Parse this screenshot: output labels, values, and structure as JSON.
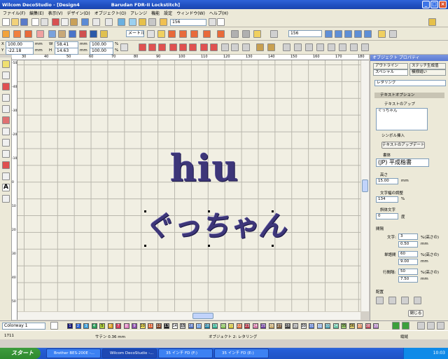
{
  "window": {
    "app": "Wilcom DecoStudio",
    "doc": "[Design4",
    "machine": "Barudan FDR-II Lockstitch]"
  },
  "menu": [
    "ファイル(F)",
    "編集(E)",
    "表示(V)",
    "デザイン(D)",
    "オブジェクト(O)",
    "アレンジ",
    "機能",
    "設定",
    "ウィンドウ(W)",
    "ヘルプ(H)"
  ],
  "toolbar1": {
    "value_156": "156",
    "value_156b": "156",
    "dropdown_label": "メートル法"
  },
  "coords": {
    "x": "100.00",
    "y": "-22.18",
    "w": "58.41",
    "h": "14.63",
    "unit": "mm",
    "sx": "100.00",
    "sy": "100.00",
    "pct": "%"
  },
  "rulers": {
    "top": [
      "30",
      "40",
      "50",
      "60",
      "70",
      "80",
      "90",
      "100",
      "110",
      "120",
      "130",
      "140",
      "150",
      "160",
      "170",
      "180"
    ],
    "left": [
      "-50",
      "-40",
      "-30",
      "-20",
      "-10",
      "0",
      "10",
      "20",
      "30",
      "40",
      "50"
    ]
  },
  "design": {
    "line1": "hiu",
    "line2": "ぐっちゃん"
  },
  "panel": {
    "title": "オブジェクト プロパティ",
    "tabs": [
      "アウトライン",
      "ステッチ生成值",
      "スペシャル",
      "模様縫い"
    ],
    "object_type": "レタリング",
    "section": "テキストオプション",
    "text_label": "テキストのアップ",
    "text_value": "ぐっちゃん",
    "symbol_label": "シンボル挿入",
    "update_button": "テキストのアップデート",
    "font_label": "書体",
    "font_value": "(JP) 平成楷書",
    "height_label": "高さ",
    "height_value": "15.00",
    "height_unit": "mm",
    "width_label": "文字幅の調整",
    "width_value": "134",
    "width_unit": "%",
    "italic_label": "斜体文字",
    "italic_value": "0",
    "italic_unit": "度",
    "spacing_label": "間隔",
    "char_label": "文字:",
    "char_value": "3",
    "char_unit": "%(高さの)",
    "char_mm": "0.50",
    "word_label": "単語間",
    "word_value": "60",
    "word_unit": "%(高さの)",
    "word_mm": "9.00",
    "line_label": "行間隔:",
    "line_value": "50",
    "line_unit": "%(高さの)",
    "line_mm": "7.50",
    "mm": "mm",
    "arrange_label": "配置",
    "close_button": "閉じる"
  },
  "colorbar": {
    "select": "Colorway 1",
    "numbers": [
      "1",
      "2",
      "3",
      "4",
      "5",
      "6",
      "7",
      "8",
      "9",
      "10",
      "11",
      "12",
      "13",
      "14",
      "15",
      "16",
      "17",
      "18",
      "19",
      "20",
      "21",
      "22",
      "23",
      "24",
      "25",
      "26",
      "27",
      "28",
      "29",
      "30",
      "31",
      "32",
      "33",
      "34",
      "35",
      "36",
      "37",
      "38",
      "39"
    ]
  },
  "status": {
    "left": "1711",
    "middle": "サテン 0.36 mm",
    "object": "オブジェクト 2: レタリング",
    "right": "縦縫"
  },
  "taskbar": {
    "start": "スタート",
    "tasks": [
      "Brother BES-200E -...",
      "Wilcom DecoStudio -...",
      "35 インチ FD (F:)",
      "35 インチ FD (E:)"
    ],
    "time": "10:03"
  },
  "colors": {
    "thread": "#3d3679",
    "accent": "#2f63d8"
  }
}
